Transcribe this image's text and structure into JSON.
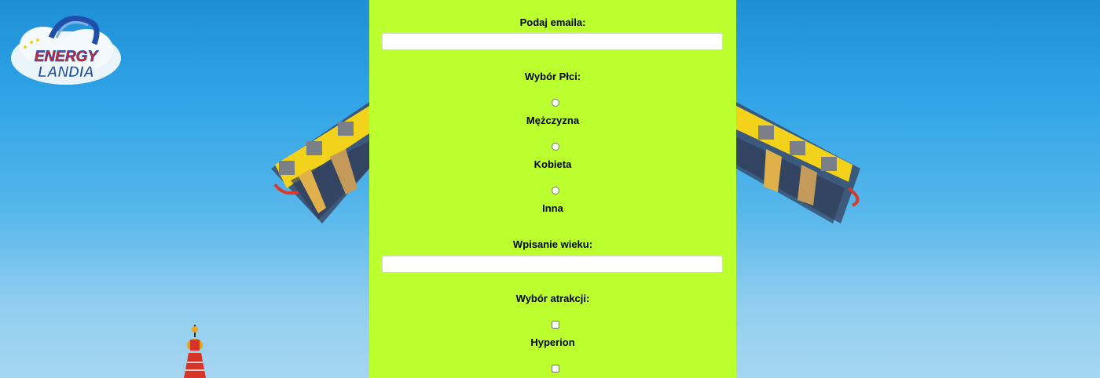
{
  "brand": {
    "logo_line1": "ENERGY",
    "logo_line2": "LANDIA"
  },
  "form": {
    "email": {
      "label": "Podaj emaila:",
      "value": "",
      "placeholder": ""
    },
    "gender": {
      "label": "Wybór Płci:",
      "options": [
        {
          "label": "Mężczyzna",
          "checked": false
        },
        {
          "label": "Kobieta",
          "checked": false
        },
        {
          "label": "Inna",
          "checked": false
        }
      ]
    },
    "age": {
      "label": "Wpisanie wieku:",
      "value": "",
      "placeholder": ""
    },
    "attractions": {
      "label": "Wybór atrakcji:",
      "options": [
        {
          "label": "Hyperion",
          "checked": false
        },
        {
          "label": "",
          "checked": false
        }
      ]
    }
  },
  "colors": {
    "panel_background": "#bbff2e",
    "sky": "#2ea3e6",
    "ride_yellow": "#f2d21b",
    "logo_red": "#e3202a",
    "logo_blue": "#1f4fa8"
  }
}
